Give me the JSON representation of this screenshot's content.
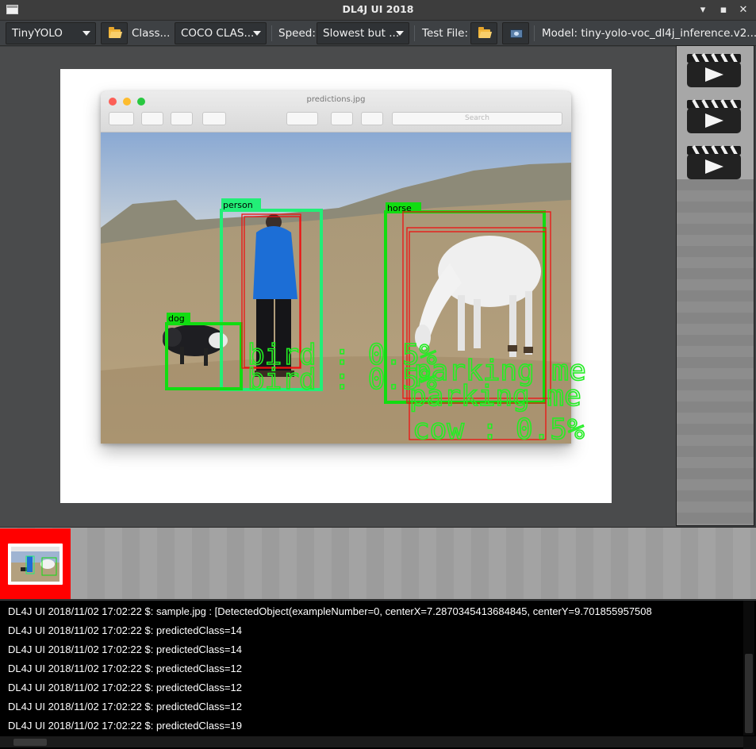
{
  "window": {
    "title": "DL4J UI 2018",
    "minimize_glyph": "▾",
    "maximize_glyph": "▪",
    "close_glyph": "✕"
  },
  "toolbar": {
    "model_combo": "TinyYOLO",
    "classes_label": "Class...",
    "classes_combo": "COCO CLAS...",
    "speed_label": "Speed:",
    "speed_combo": "Slowest but ...",
    "test_file_label": "Test File:",
    "model_info": "Model: tiny-yolo-voc_dl4j_inference.v2...."
  },
  "preview": {
    "filename": "predictions.jpg",
    "search_placeholder": "Search",
    "detections": [
      {
        "label": "person",
        "color": "#22ee77"
      },
      {
        "label": "horse",
        "color": "#11dd11"
      },
      {
        "label": "dog",
        "color": "#11dd11"
      }
    ],
    "overlay_text": [
      {
        "text": "bird : 0.5%"
      },
      {
        "text": "bird : 0.5%"
      },
      {
        "text": "parking me"
      },
      {
        "text": "parking me"
      },
      {
        "text": "cow : 0.5%"
      }
    ]
  },
  "side_panel": {
    "actions": [
      {
        "name": "play-video-1"
      },
      {
        "name": "play-video-2"
      },
      {
        "name": "play-video-3"
      }
    ]
  },
  "thumbnails": {
    "selected_color": "#ff0000"
  },
  "console": {
    "lines": [
      "DL4J UI 2018/11/02 17:02:22 $: sample.jpg : [DetectedObject(exampleNumber=0, centerX=7.2870345413684845, centerY=9.701855957508",
      "DL4J UI 2018/11/02 17:02:22 $: predictedClass=14",
      "DL4J UI 2018/11/02 17:02:22 $: predictedClass=14",
      "DL4J UI 2018/11/02 17:02:22 $: predictedClass=12",
      "DL4J UI 2018/11/02 17:02:22 $: predictedClass=12",
      "DL4J UI 2018/11/02 17:02:22 $: predictedClass=12",
      "DL4J UI 2018/11/02 17:02:22 $: predictedClass=19"
    ]
  }
}
